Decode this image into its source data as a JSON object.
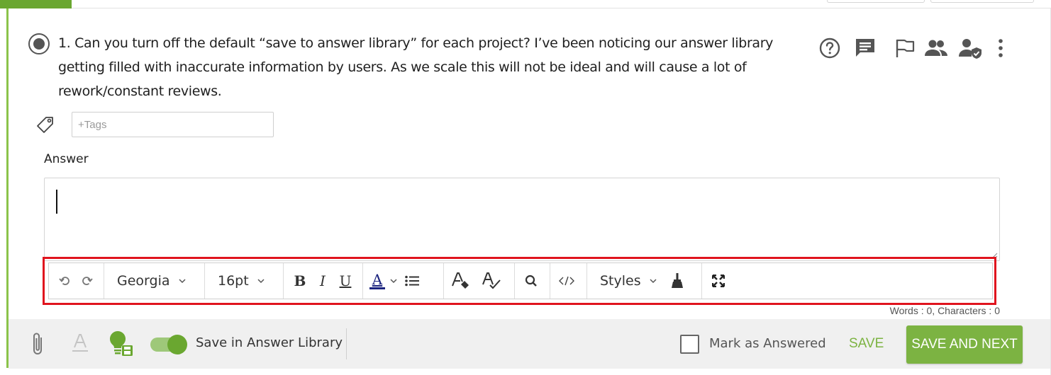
{
  "question": {
    "number_and_text": "1. Can you turn off the default “save to answer library” for each project? I’ve been noticing our answer library getting filled with inaccurate information by users. As we scale this will not be ideal and will cause a lot of rework/constant reviews.",
    "icons": [
      "help-circle-icon",
      "comment-icon",
      "flag-icon",
      "assignees-icon",
      "reviewer-verified-icon",
      "more-vertical-icon"
    ]
  },
  "tags": {
    "placeholder": "+Tags",
    "value": ""
  },
  "answer": {
    "label": "Answer",
    "value": ""
  },
  "toolbar": {
    "font_family": "Georgia",
    "font_size": "16pt",
    "styles_label": "Styles",
    "bold": "B",
    "italic": "I",
    "underline": "U",
    "font_color_glyph": "A",
    "font_color": "#1a237e"
  },
  "counts": "Words : 0, Characters : 0",
  "footer": {
    "toggle_label": "Save in Answer Library",
    "toggle_on": true,
    "mark_label": "Mark as Answered",
    "mark_checked": false,
    "save_label": "SAVE",
    "save_next_label": "SAVE AND NEXT"
  },
  "colors": {
    "accent": "#7cb342",
    "accent_dark": "#6aa730",
    "highlight": "#e0141e"
  }
}
